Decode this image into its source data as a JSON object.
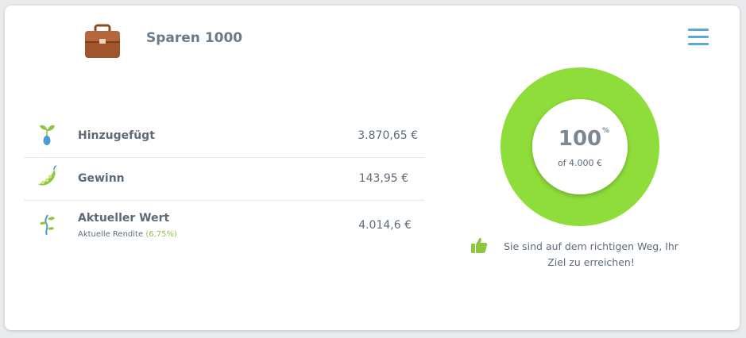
{
  "header": {
    "title": "Sparen 1000",
    "icon": "briefcase-icon",
    "menu_icon": "hamburger-menu-icon"
  },
  "rows": [
    {
      "icon": "seedling-icon",
      "label": "Hinzugefügt",
      "value": "3.870,65 €"
    },
    {
      "icon": "pea-pod-icon",
      "label": "Gewinn",
      "value": "143,95 €"
    },
    {
      "icon": "sprout-growth-icon",
      "label": "Aktueller Wert",
      "sub_label": "Aktuelle Rendite",
      "sub_value": "(6,75%)",
      "value": "4.014,6 €"
    }
  ],
  "progress": {
    "value": "100",
    "unit": "%",
    "fraction": 1.0,
    "target": "of 4.000 €",
    "color": "#8fdd3a"
  },
  "message": {
    "icon": "thumbs-up-icon",
    "text": "Sie sind auf dem richtigen Weg, Ihr Ziel zu erreichen!"
  }
}
